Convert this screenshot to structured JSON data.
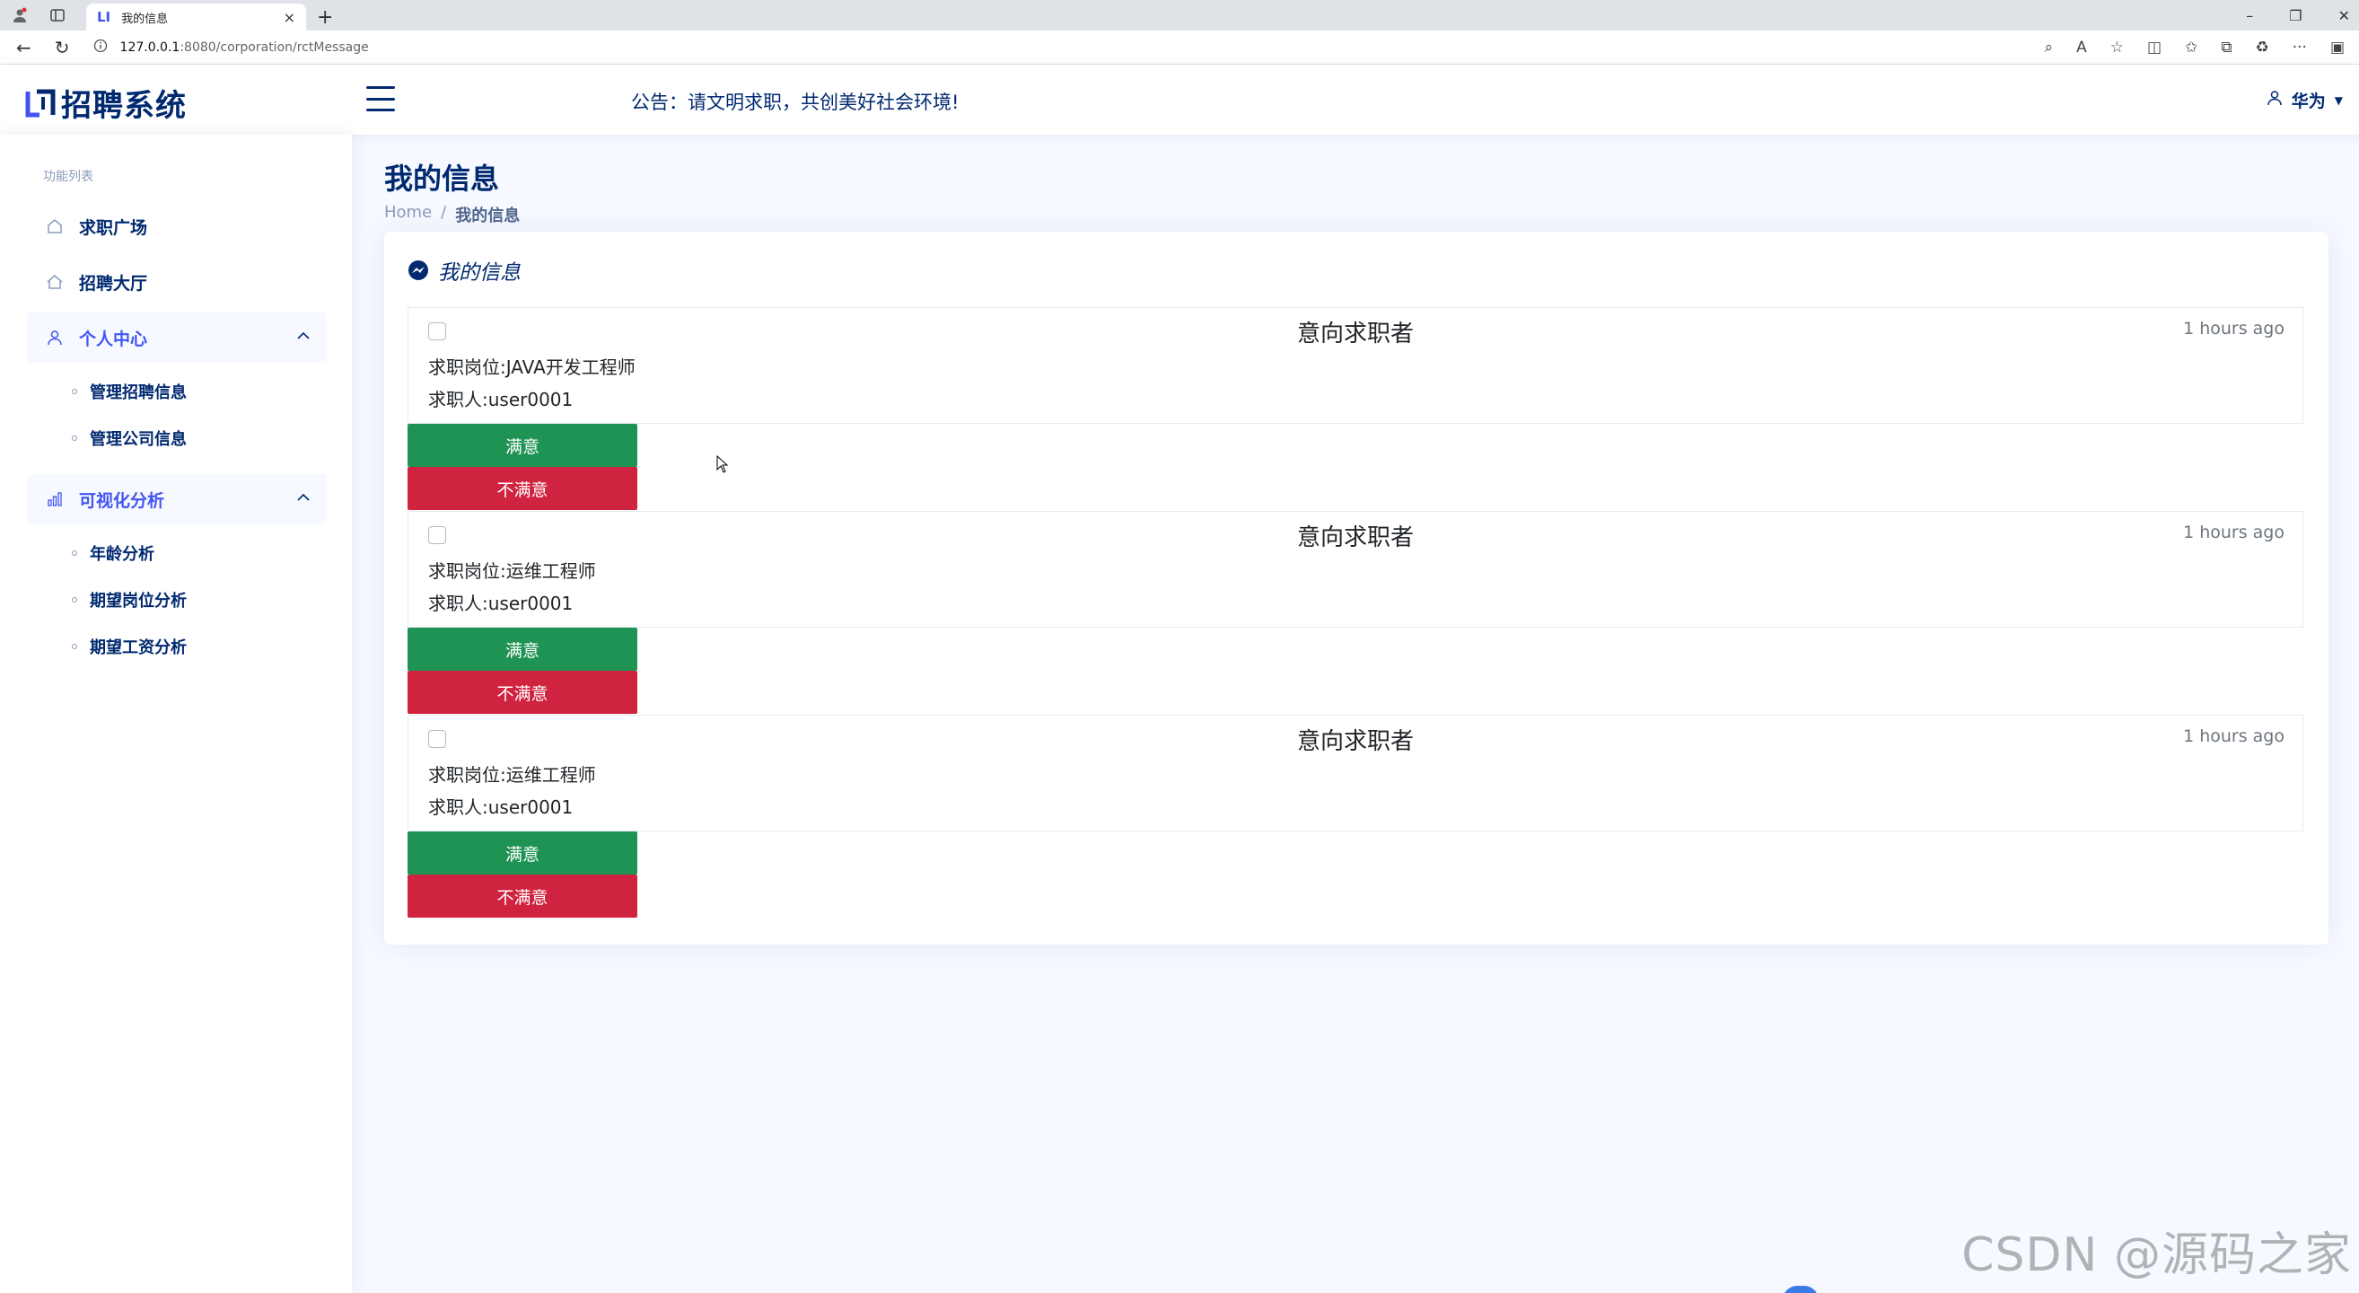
{
  "browser": {
    "tab_title": "我的信息",
    "tab_favicon": "LI",
    "url_host": "127.0.0.1",
    "url_path": ":8080/corporation/rctMessage",
    "new_tab": "+",
    "close": "×"
  },
  "header": {
    "logo_text": "招聘系统",
    "notice": "公告：请文明求职，共创美好社会环境!",
    "user_name": "华为"
  },
  "sidebar": {
    "heading": "功能列表",
    "items": [
      {
        "label": "求职广场"
      },
      {
        "label": "招聘大厅"
      },
      {
        "label": "个人中心",
        "children": [
          {
            "label": "管理招聘信息"
          },
          {
            "label": "管理公司信息"
          }
        ]
      },
      {
        "label": "可视化分析",
        "children": [
          {
            "label": "年龄分析"
          },
          {
            "label": "期望岗位分析"
          },
          {
            "label": "期望工资分析"
          }
        ]
      }
    ]
  },
  "page": {
    "title": "我的信息",
    "breadcrumb_home": "Home",
    "breadcrumb_sep": "/",
    "breadcrumb_current": "我的信息",
    "card_title": "我的信息"
  },
  "messages": [
    {
      "head": "意向求职者",
      "time": "1 hours ago",
      "position": "求职岗位:JAVA开发工程师",
      "applicant": "求职人:user0001",
      "ok_label": "满意",
      "bad_label": "不满意"
    },
    {
      "head": "意向求职者",
      "time": "1 hours ago",
      "position": "求职岗位:运维工程师",
      "applicant": "求职人:user0001",
      "ok_label": "满意",
      "bad_label": "不满意"
    },
    {
      "head": "意向求职者",
      "time": "1 hours ago",
      "position": "求职岗位:运维工程师",
      "applicant": "求职人:user0001",
      "ok_label": "满意",
      "bad_label": "不满意"
    }
  ],
  "watermark": "CSDN @源码之家",
  "colors": {
    "primary": "#012970",
    "accent": "#4154f1",
    "success": "#1f9353",
    "danger": "#d0233f"
  }
}
